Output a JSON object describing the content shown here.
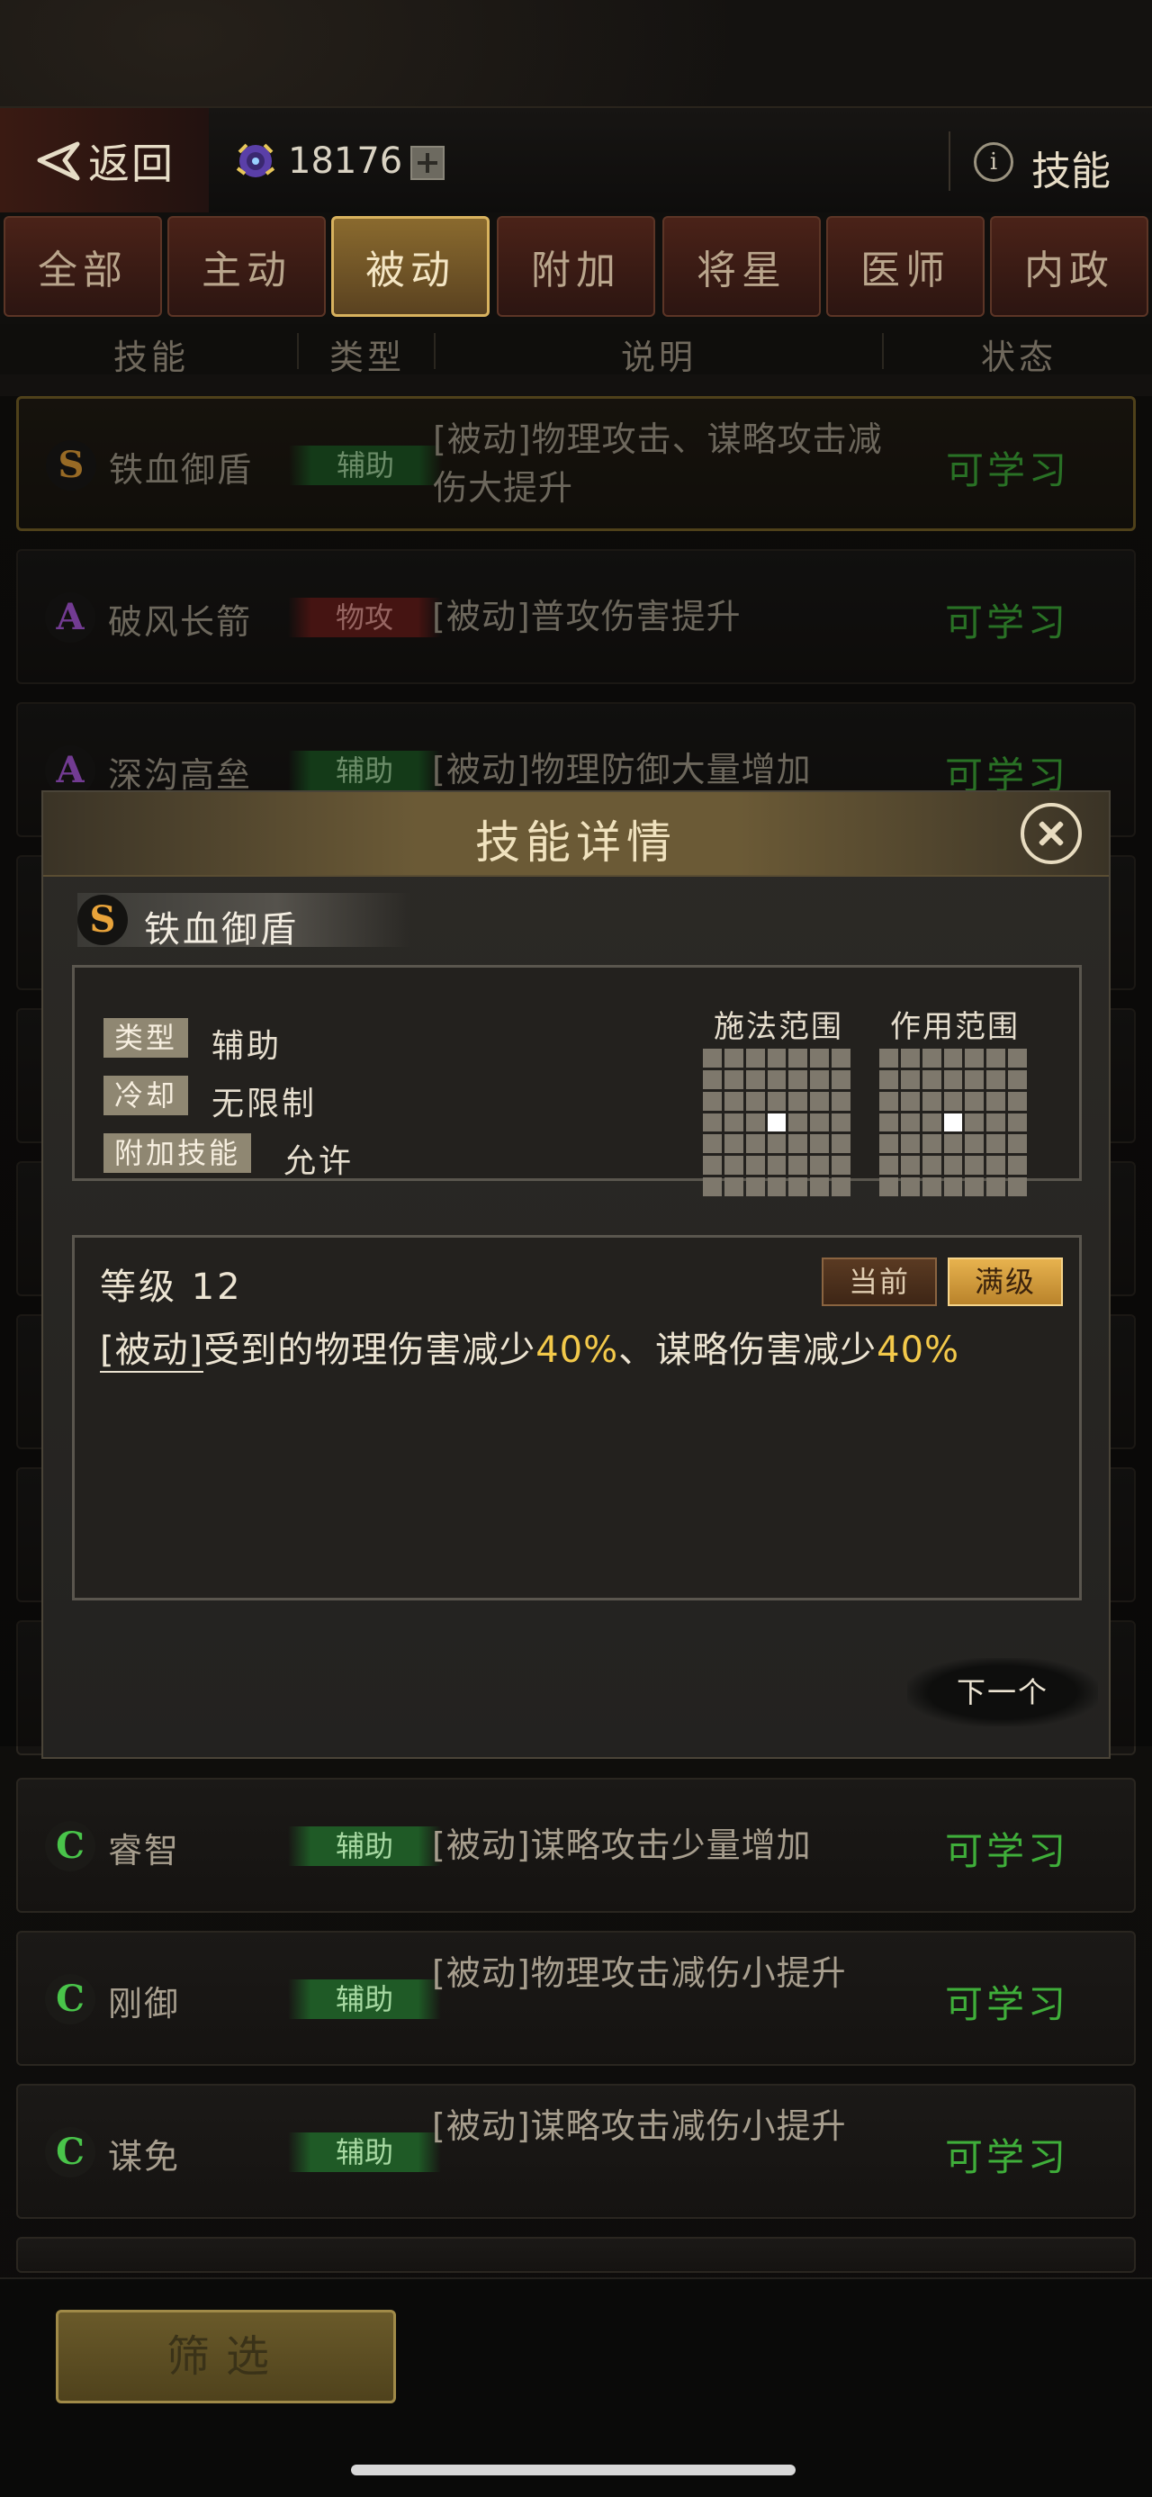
{
  "topbar": {
    "back_label": "返回",
    "currency_value": "18176",
    "title": "技能"
  },
  "tabs": [
    "全部",
    "主动",
    "被动",
    "附加",
    "将星",
    "医师",
    "内政"
  ],
  "active_tab_index": 2,
  "columns": {
    "skill": "技能",
    "type": "类型",
    "desc": "说明",
    "status": "状态"
  },
  "rows": [
    {
      "rank": "S",
      "name": "铁血御盾",
      "type": "辅助",
      "type_color": "green",
      "desc": "[被动]物理攻击、谋略攻击减伤大提升",
      "status": "可学习"
    },
    {
      "rank": "A",
      "name": "破风长箭",
      "type": "物攻",
      "type_color": "red",
      "desc": "[被动]普攻伤害提升",
      "status": "可学习"
    },
    {
      "rank": "A",
      "name": "深沟高垒",
      "type": "辅助",
      "type_color": "green",
      "desc": "[被动]物理防御大量增加",
      "status": "可学习"
    },
    {
      "rank": "C",
      "name": "睿智",
      "type": "辅助",
      "type_color": "green",
      "desc": "[被动]谋略攻击少量增加",
      "status": "可学习"
    },
    {
      "rank": "C",
      "name": "刚御",
      "type": "辅助",
      "type_color": "green",
      "desc": "[被动]物理攻击减伤小提升",
      "status": "可学习"
    },
    {
      "rank": "C",
      "name": "谋免",
      "type": "辅助",
      "type_color": "green",
      "desc": "[被动]谋略攻击减伤小提升",
      "status": "可学习"
    }
  ],
  "modal": {
    "title": "技能详情",
    "skill_rank": "S",
    "skill_name": "铁血御盾",
    "attrs": [
      {
        "label": "类型",
        "value": "辅助"
      },
      {
        "label": "冷却",
        "value": "无限制"
      },
      {
        "label": "附加技能",
        "value": "允许"
      }
    ],
    "cast_range_label": "施法范围",
    "effect_range_label": "作用范围",
    "level_text": "等级 12",
    "current_btn": "当前",
    "max_btn": "满级",
    "desc_keyword": "[被动]",
    "desc_part1": "受到的物理伤害减少",
    "desc_val1": "40%",
    "desc_part2": "、谋略伤害减少",
    "desc_val2": "40%",
    "next_btn": "下一个"
  },
  "filter_label": "筛选",
  "colors": {
    "learnable": "#3fae3a",
    "accent_gold": "#d8b25e",
    "highlight": "#f3c94a"
  }
}
